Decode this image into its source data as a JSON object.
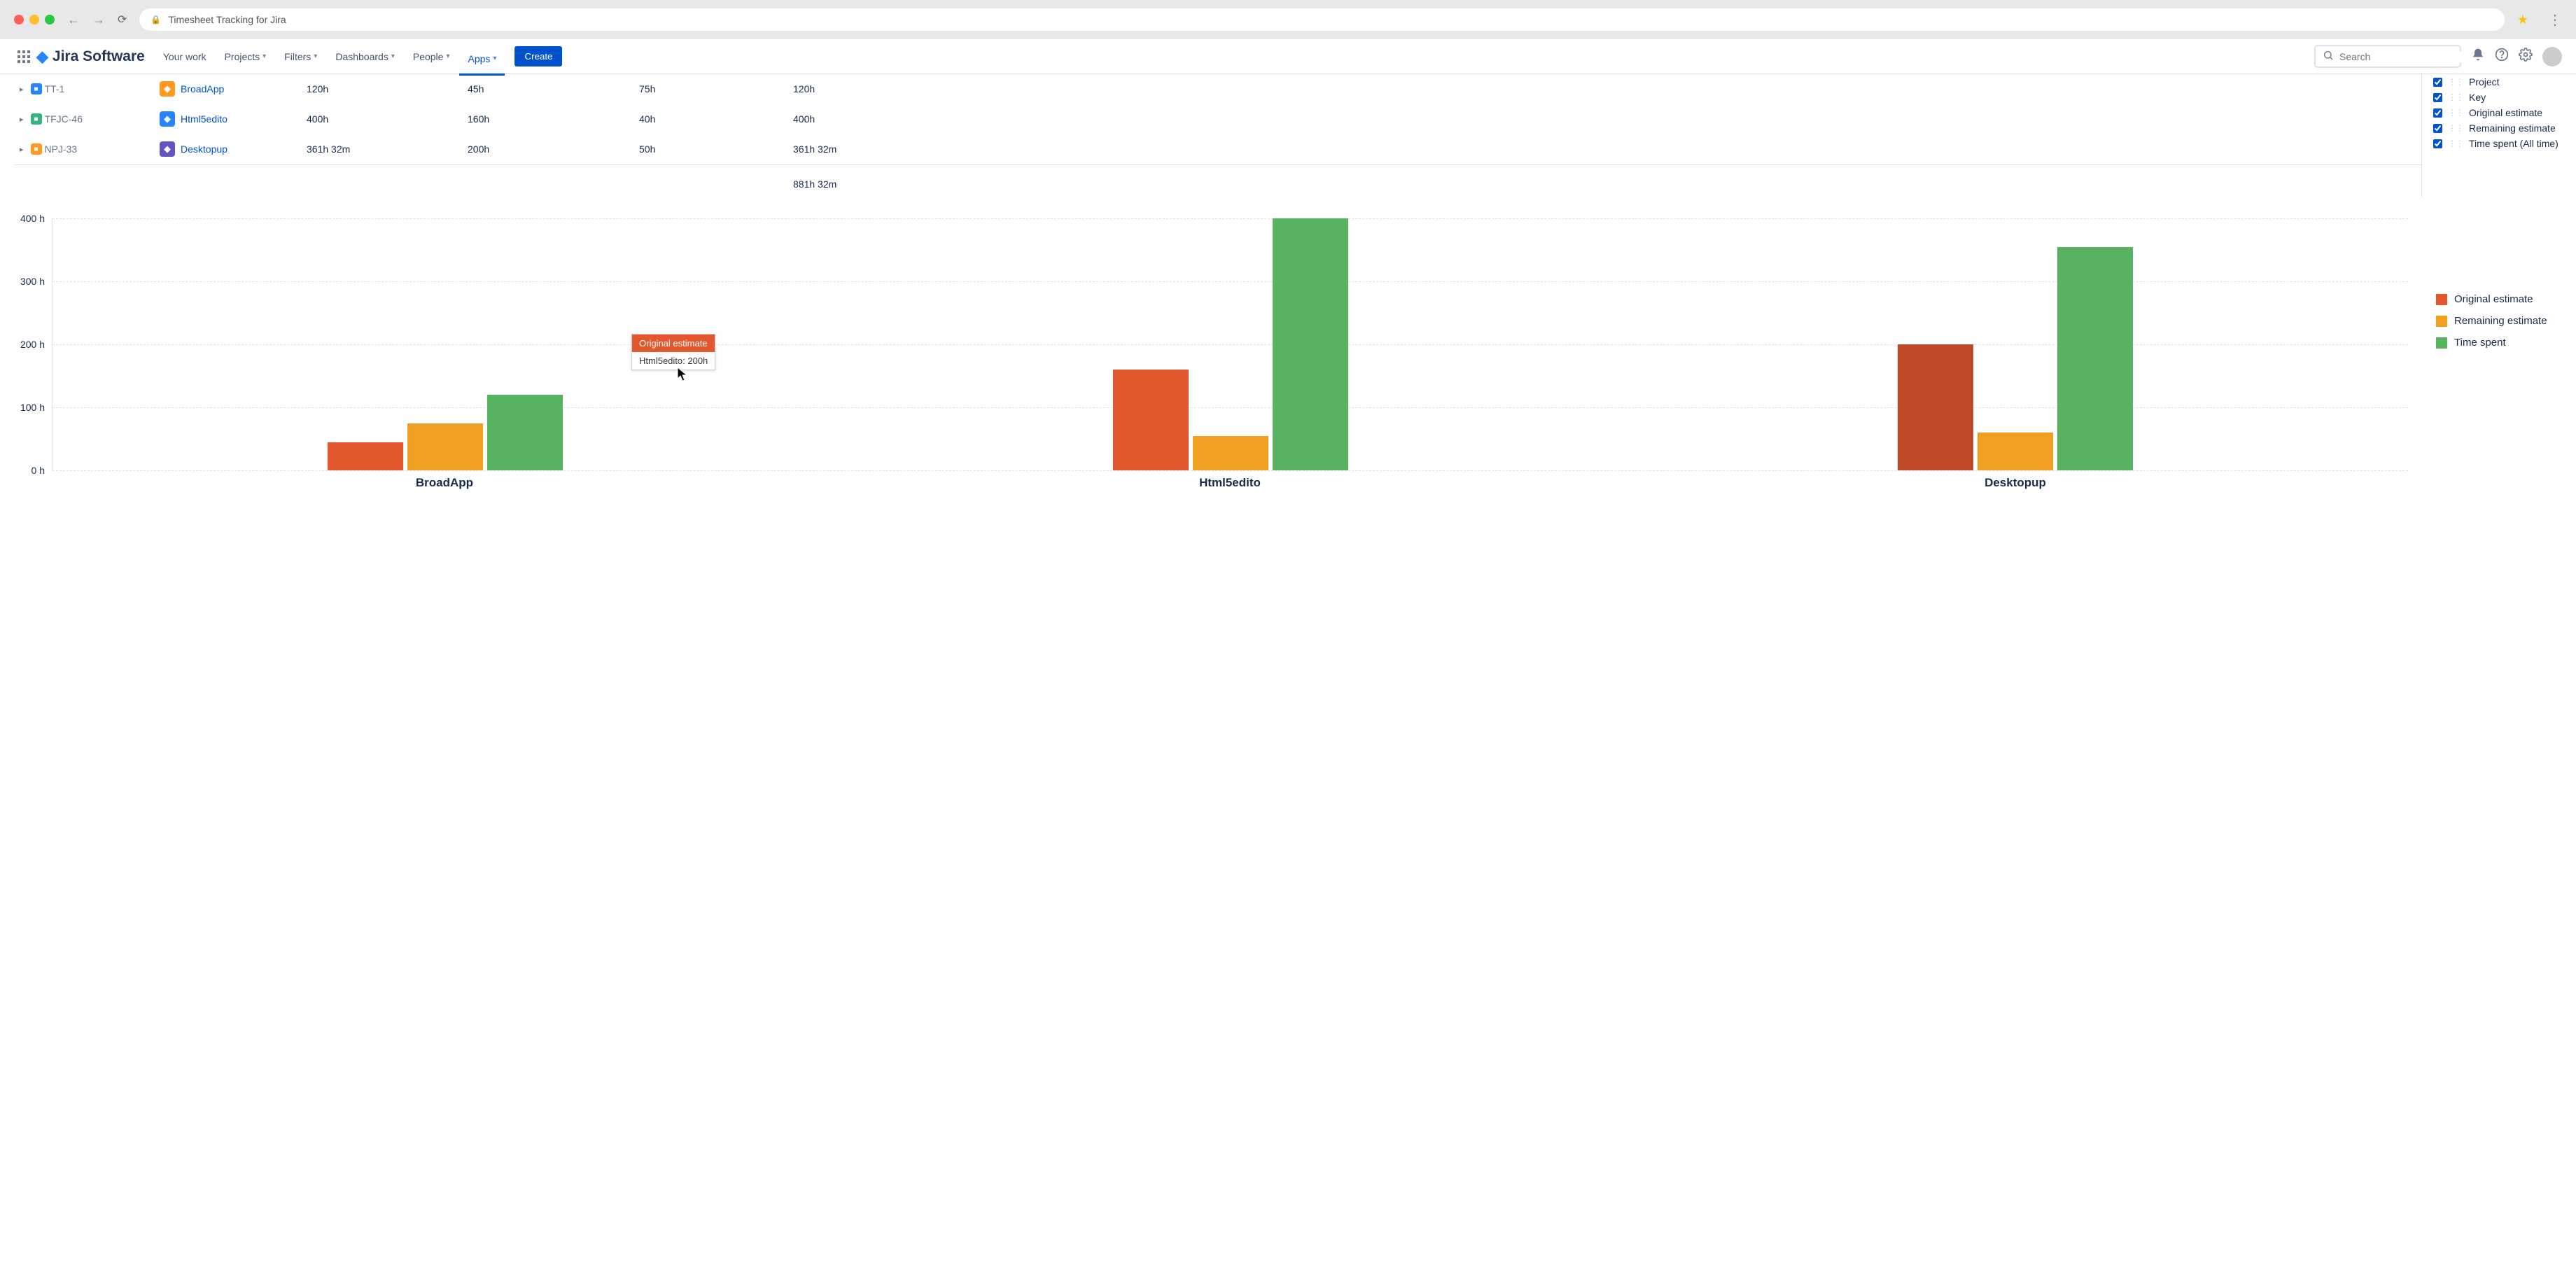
{
  "browser": {
    "title": "Timesheet Tracking for Jira"
  },
  "nav": {
    "product": "Jira Software",
    "items": [
      "Your work",
      "Projects",
      "Filters",
      "Dashboards",
      "People",
      "Apps"
    ],
    "active": "Apps",
    "create": "Create",
    "search_placeholder": "Search"
  },
  "table_rows": [
    {
      "key": "TT-1",
      "issue_type": "blue",
      "project": "BroadApp",
      "proj_color": "orange",
      "c1": "120h",
      "c2": "45h",
      "c3": "75h",
      "c4": "120h"
    },
    {
      "key": "TFJC-46",
      "issue_type": "green",
      "project": "Html5edito",
      "proj_color": "blue",
      "c1": "400h",
      "c2": "160h",
      "c3": "40h",
      "c4": "400h"
    },
    {
      "key": "NPJ-33",
      "issue_type": "orange",
      "project": "Desktopup",
      "proj_color": "purple",
      "c1": "361h 32m",
      "c2": "200h",
      "c3": "50h",
      "c4": "361h 32m"
    }
  ],
  "total": "881h 32m",
  "columns": [
    {
      "label": "Project",
      "checked": true
    },
    {
      "label": "Key",
      "checked": true
    },
    {
      "label": "Original estimate",
      "checked": true
    },
    {
      "label": "Remaining estimate",
      "checked": true
    },
    {
      "label": "Time spent (All time)",
      "checked": true
    }
  ],
  "tooltip": {
    "header": "Original estimate",
    "body": "Html5edito: 200h"
  },
  "chart_data": {
    "type": "bar",
    "categories": [
      "BroadApp",
      "Html5edito",
      "Desktopup"
    ],
    "series": [
      {
        "name": "Original estimate",
        "values": [
          45,
          160,
          200
        ],
        "color": "#e2572e"
      },
      {
        "name": "Remaining estimate",
        "values": [
          75,
          55,
          60
        ],
        "color": "#f0a020"
      },
      {
        "name": "Time spent",
        "values": [
          120,
          400,
          355
        ],
        "color": "#57b360"
      }
    ],
    "ylabel": "h",
    "ylim": [
      0,
      400
    ],
    "y_ticks": [
      0,
      100,
      200,
      300,
      400
    ],
    "legend_position": "right",
    "hover": {
      "category": "Desktopup",
      "series": "Original estimate"
    }
  },
  "legend_labels": [
    "Original estimate",
    "Remaining estimate",
    "Time spent"
  ]
}
